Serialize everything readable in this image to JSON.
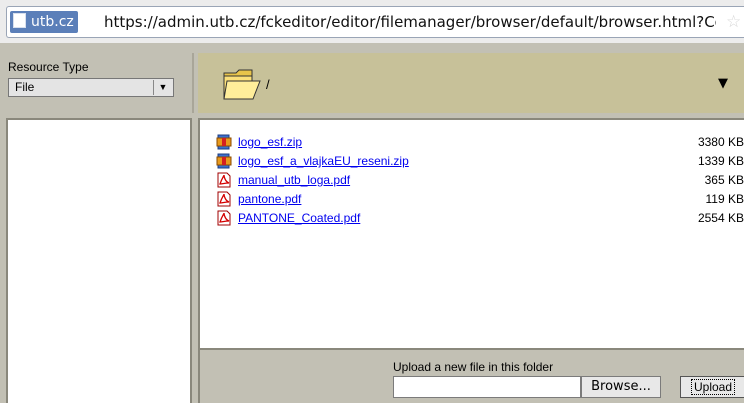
{
  "urlbar": {
    "site_identity": "utb.cz",
    "url": "https://admin.utb.cz/fckeditor/editor/filemanager/browser/default/browser.html?Co"
  },
  "resource_type": {
    "label": "Resource Type",
    "selected": "File"
  },
  "path": {
    "current": "/"
  },
  "files": [
    {
      "name": "logo_esf.zip",
      "size": "3380 KB",
      "icon": "zip-file-icon"
    },
    {
      "name": "logo_esf_a_vlajkaEU_reseni.zip",
      "size": "1339 KB",
      "icon": "zip-file-icon"
    },
    {
      "name": "manual_utb_loga.pdf",
      "size": "365 KB",
      "icon": "pdf-file-icon"
    },
    {
      "name": "pantone.pdf",
      "size": "119 KB",
      "icon": "pdf-file-icon"
    },
    {
      "name": "PANTONE_Coated.pdf",
      "size": "2554 KB",
      "icon": "pdf-file-icon"
    }
  ],
  "upload": {
    "label": "Upload a new file in this folder",
    "browse_label": "Browse...",
    "upload_label": "Upload"
  }
}
